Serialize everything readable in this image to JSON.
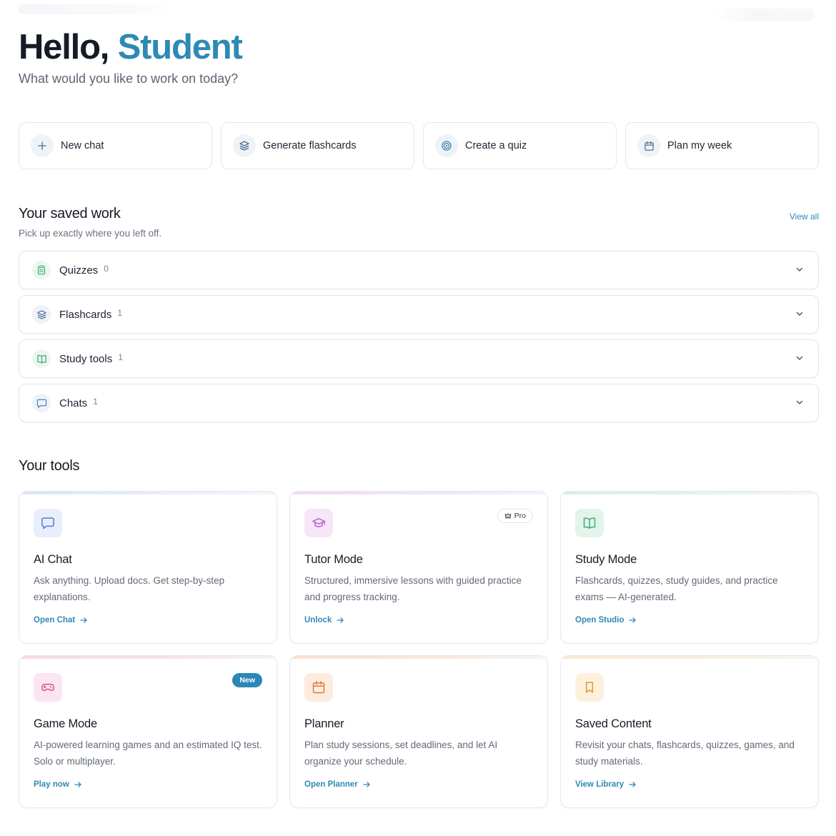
{
  "hero": {
    "greeting": "Hello,",
    "name": "Student",
    "subtitle": "What would you like to work on today?"
  },
  "quick_actions": [
    {
      "label": "New chat",
      "icon": "plus-icon"
    },
    {
      "label": "Generate flashcards",
      "icon": "layers-icon"
    },
    {
      "label": "Create a quiz",
      "icon": "target-icon"
    },
    {
      "label": "Plan my week",
      "icon": "calendar-icon"
    }
  ],
  "saved": {
    "title": "Your saved work",
    "subtitle": "Pick up exactly where you left off.",
    "view_all": "View all",
    "items": [
      {
        "label": "Quizzes",
        "count": "0",
        "icon": "clipboard-icon"
      },
      {
        "label": "Flashcards",
        "count": "1",
        "icon": "layers-icon"
      },
      {
        "label": "Study tools",
        "count": "1",
        "icon": "book-open-icon"
      },
      {
        "label": "Chats",
        "count": "1",
        "icon": "chat-bubble-icon"
      }
    ]
  },
  "tools": {
    "title": "Your tools",
    "cards": [
      {
        "title": "AI Chat",
        "desc": "Ask anything. Upload docs. Get step-by-step explanations.",
        "link": "Open Chat",
        "icon": "chat-bubble-icon"
      },
      {
        "title": "Tutor Mode",
        "desc": "Structured, immersive lessons with guided practice and progress tracking.",
        "link": "Unlock",
        "icon": "graduation-cap-icon",
        "badge": "Pro"
      },
      {
        "title": "Study Mode",
        "desc": "Flashcards, quizzes, study guides, and practice exams — AI-generated.",
        "link": "Open Studio",
        "icon": "book-open-icon"
      },
      {
        "title": "Game Mode",
        "desc": "AI-powered learning games and an estimated IQ test. Solo or multiplayer.",
        "link": "Play now",
        "icon": "gamepad-icon",
        "badge": "New"
      },
      {
        "title": "Planner",
        "desc": "Plan study sessions, set deadlines, and let AI organize your schedule.",
        "link": "Open Planner",
        "icon": "calendar-icon"
      },
      {
        "title": "Saved Content",
        "desc": "Revisit your chats, flashcards, quizzes, games, and study materials.",
        "link": "View Library",
        "icon": "bookmark-icon"
      }
    ]
  },
  "colors": {
    "accent": "#2f89b5",
    "chat": "#4f7fd1",
    "tutor": "#b25cc9",
    "study": "#3fae7a",
    "game": "#d6528f",
    "planner": "#e07a3c",
    "saved": "#d69a2a"
  }
}
